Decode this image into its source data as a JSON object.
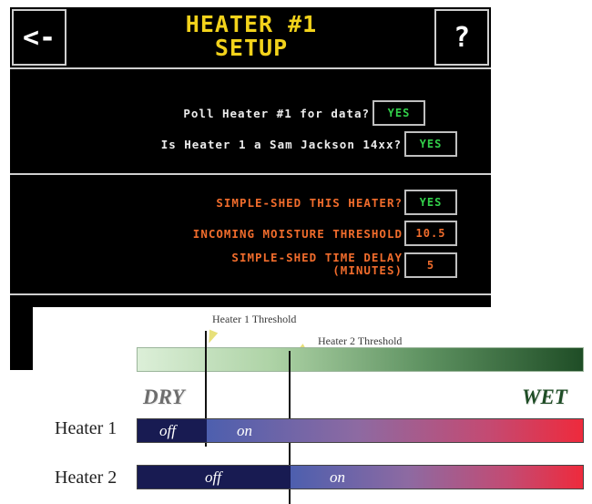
{
  "setup_screen": {
    "back_label": "<-",
    "help_label": "?",
    "title_line1": "HEATER #1",
    "title_line2": "SETUP",
    "poll_label": "Poll Heater #1 for data?",
    "poll_value": "YES",
    "model_label": "Is Heater 1 a Sam Jackson 14xx?",
    "model_value": "YES",
    "shed_label": "SIMPLE-SHED THIS HEATER?",
    "shed_value": "YES",
    "threshold_label": "INCOMING MOISTURE THRESHOLD",
    "threshold_value": "10.5",
    "delay_label_line1": "SIMPLE-SHED TIME DELAY",
    "delay_label_line2": "(MINUTES)",
    "delay_value": "5",
    "colors": {
      "title": "#f2d21b",
      "orange_text": "#f06c2c",
      "green_value": "#32d04a"
    }
  },
  "diagram": {
    "heater1_threshold_label": "Heater 1 Threshold",
    "heater2_threshold_label": "Heater 2 Threshold",
    "dry_label": "DRY",
    "wet_label": "WET",
    "rows": [
      {
        "name": "Heater 1",
        "off_label": "off",
        "on_label": "on"
      },
      {
        "name": "Heater 2",
        "off_label": "off",
        "on_label": "on"
      }
    ],
    "colors": {
      "off": "#181b52",
      "on_start": "#4d5fae",
      "on_end": "#ee2a3c",
      "moisture_dry": "#dcefd8",
      "moisture_wet": "#1f4d26"
    }
  }
}
